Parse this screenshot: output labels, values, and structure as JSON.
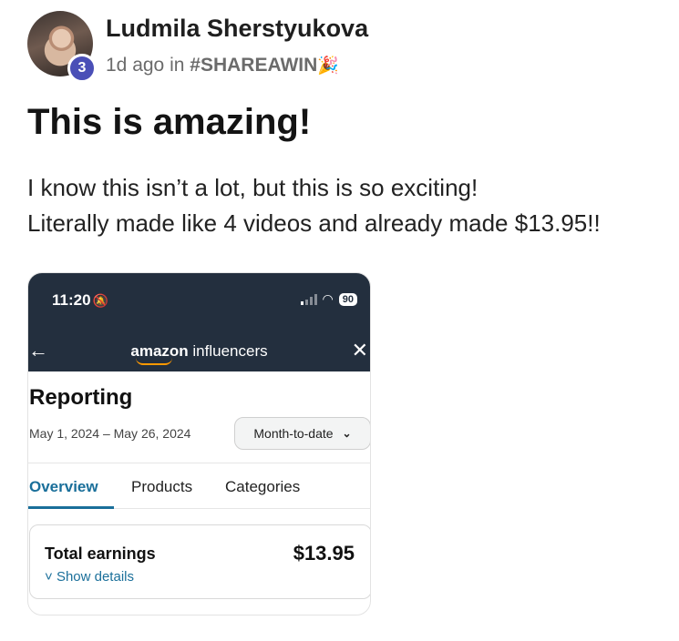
{
  "post": {
    "author": "Ludmila Sherstyukova",
    "level": "3",
    "time": "1d ago in",
    "channel": "#SHAREAWIN",
    "title": "This is amazing!",
    "body_line1": "I know this isn’t a lot, but this is so exciting!",
    "body_line2": "Literally made like 4 videos and already made $13.95!!"
  },
  "screenshot": {
    "status_time": "11:20",
    "battery": "90",
    "brand_amazon": "amazon",
    "brand_influencers": "influencers",
    "page_title": "Reporting",
    "date_range": "May 1, 2024 – May 26, 2024",
    "range_select": "Month-to-date",
    "tabs": [
      "Overview",
      "Products",
      "Categories"
    ],
    "earnings_label": "Total earnings",
    "earnings_value": "$13.95",
    "show_details": "Show details"
  },
  "colors": {
    "header_bg": "#232f3e",
    "accent": "#1a6f9a",
    "badge": "#4a4fb7"
  }
}
